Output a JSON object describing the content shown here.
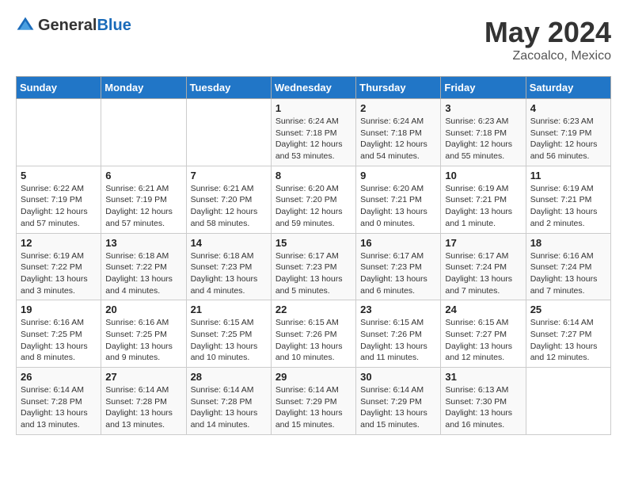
{
  "header": {
    "logo_general": "General",
    "logo_blue": "Blue",
    "month": "May 2024",
    "location": "Zacoalco, Mexico"
  },
  "days_of_week": [
    "Sunday",
    "Monday",
    "Tuesday",
    "Wednesday",
    "Thursday",
    "Friday",
    "Saturday"
  ],
  "weeks": [
    [
      {
        "day": "",
        "info": ""
      },
      {
        "day": "",
        "info": ""
      },
      {
        "day": "",
        "info": ""
      },
      {
        "day": "1",
        "info": "Sunrise: 6:24 AM\nSunset: 7:18 PM\nDaylight: 12 hours\nand 53 minutes."
      },
      {
        "day": "2",
        "info": "Sunrise: 6:24 AM\nSunset: 7:18 PM\nDaylight: 12 hours\nand 54 minutes."
      },
      {
        "day": "3",
        "info": "Sunrise: 6:23 AM\nSunset: 7:18 PM\nDaylight: 12 hours\nand 55 minutes."
      },
      {
        "day": "4",
        "info": "Sunrise: 6:23 AM\nSunset: 7:19 PM\nDaylight: 12 hours\nand 56 minutes."
      }
    ],
    [
      {
        "day": "5",
        "info": "Sunrise: 6:22 AM\nSunset: 7:19 PM\nDaylight: 12 hours\nand 57 minutes."
      },
      {
        "day": "6",
        "info": "Sunrise: 6:21 AM\nSunset: 7:19 PM\nDaylight: 12 hours\nand 57 minutes."
      },
      {
        "day": "7",
        "info": "Sunrise: 6:21 AM\nSunset: 7:20 PM\nDaylight: 12 hours\nand 58 minutes."
      },
      {
        "day": "8",
        "info": "Sunrise: 6:20 AM\nSunset: 7:20 PM\nDaylight: 12 hours\nand 59 minutes."
      },
      {
        "day": "9",
        "info": "Sunrise: 6:20 AM\nSunset: 7:21 PM\nDaylight: 13 hours\nand 0 minutes."
      },
      {
        "day": "10",
        "info": "Sunrise: 6:19 AM\nSunset: 7:21 PM\nDaylight: 13 hours\nand 1 minute."
      },
      {
        "day": "11",
        "info": "Sunrise: 6:19 AM\nSunset: 7:21 PM\nDaylight: 13 hours\nand 2 minutes."
      }
    ],
    [
      {
        "day": "12",
        "info": "Sunrise: 6:19 AM\nSunset: 7:22 PM\nDaylight: 13 hours\nand 3 minutes."
      },
      {
        "day": "13",
        "info": "Sunrise: 6:18 AM\nSunset: 7:22 PM\nDaylight: 13 hours\nand 4 minutes."
      },
      {
        "day": "14",
        "info": "Sunrise: 6:18 AM\nSunset: 7:23 PM\nDaylight: 13 hours\nand 4 minutes."
      },
      {
        "day": "15",
        "info": "Sunrise: 6:17 AM\nSunset: 7:23 PM\nDaylight: 13 hours\nand 5 minutes."
      },
      {
        "day": "16",
        "info": "Sunrise: 6:17 AM\nSunset: 7:23 PM\nDaylight: 13 hours\nand 6 minutes."
      },
      {
        "day": "17",
        "info": "Sunrise: 6:17 AM\nSunset: 7:24 PM\nDaylight: 13 hours\nand 7 minutes."
      },
      {
        "day": "18",
        "info": "Sunrise: 6:16 AM\nSunset: 7:24 PM\nDaylight: 13 hours\nand 7 minutes."
      }
    ],
    [
      {
        "day": "19",
        "info": "Sunrise: 6:16 AM\nSunset: 7:25 PM\nDaylight: 13 hours\nand 8 minutes."
      },
      {
        "day": "20",
        "info": "Sunrise: 6:16 AM\nSunset: 7:25 PM\nDaylight: 13 hours\nand 9 minutes."
      },
      {
        "day": "21",
        "info": "Sunrise: 6:15 AM\nSunset: 7:25 PM\nDaylight: 13 hours\nand 10 minutes."
      },
      {
        "day": "22",
        "info": "Sunrise: 6:15 AM\nSunset: 7:26 PM\nDaylight: 13 hours\nand 10 minutes."
      },
      {
        "day": "23",
        "info": "Sunrise: 6:15 AM\nSunset: 7:26 PM\nDaylight: 13 hours\nand 11 minutes."
      },
      {
        "day": "24",
        "info": "Sunrise: 6:15 AM\nSunset: 7:27 PM\nDaylight: 13 hours\nand 12 minutes."
      },
      {
        "day": "25",
        "info": "Sunrise: 6:14 AM\nSunset: 7:27 PM\nDaylight: 13 hours\nand 12 minutes."
      }
    ],
    [
      {
        "day": "26",
        "info": "Sunrise: 6:14 AM\nSunset: 7:28 PM\nDaylight: 13 hours\nand 13 minutes."
      },
      {
        "day": "27",
        "info": "Sunrise: 6:14 AM\nSunset: 7:28 PM\nDaylight: 13 hours\nand 13 minutes."
      },
      {
        "day": "28",
        "info": "Sunrise: 6:14 AM\nSunset: 7:28 PM\nDaylight: 13 hours\nand 14 minutes."
      },
      {
        "day": "29",
        "info": "Sunrise: 6:14 AM\nSunset: 7:29 PM\nDaylight: 13 hours\nand 15 minutes."
      },
      {
        "day": "30",
        "info": "Sunrise: 6:14 AM\nSunset: 7:29 PM\nDaylight: 13 hours\nand 15 minutes."
      },
      {
        "day": "31",
        "info": "Sunrise: 6:13 AM\nSunset: 7:30 PM\nDaylight: 13 hours\nand 16 minutes."
      },
      {
        "day": "",
        "info": ""
      }
    ]
  ]
}
